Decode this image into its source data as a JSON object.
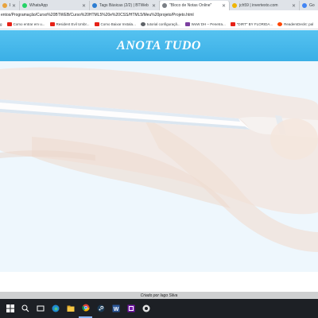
{
  "browser": {
    "tabs": [
      {
        "label": "EUZ | ...",
        "favicon_color": "#e8a33d",
        "active": false
      },
      {
        "label": "WhatsApp",
        "favicon_color": "#25d366",
        "active": false
      },
      {
        "label": "Tags Básicas (2/2) | BTWeb",
        "favicon_color": "#2d7dd2",
        "active": false
      },
      {
        "label": "\"Bloco de Notas Online\"",
        "favicon_color": "#7a7f85",
        "active": true
      },
      {
        "label": "jch59 | invertexto.com",
        "favicon_color": "#f0b400",
        "active": false
      },
      {
        "label": "Go",
        "favicon_color": "#4285f4",
        "active": false
      }
    ],
    "address": "entos/Programação/Curso%20BTWEB/Curso%20HTML5%20e%20CSS/HTML5/Meu%20projeto/Projeto.html",
    "bookmarks": [
      {
        "label": "g",
        "icon": "yt"
      },
      {
        "label": "Como entrar em u...",
        "icon": "yt"
      },
      {
        "label": "Resident Evil Umbr...",
        "icon": "yt"
      },
      {
        "label": "Como Baixar Instala...",
        "icon": "yt"
      },
      {
        "label": "tutorial configuraçã...",
        "icon": "gear"
      },
      {
        "label": "WoW DH – Penetra...",
        "icon": "purple"
      },
      {
        "label": "\"DIRT\" BY FLORIDA...",
        "icon": "yt"
      },
      {
        "label": "ReadersDeckt: pal",
        "icon": "reddit"
      }
    ]
  },
  "page": {
    "title": "ANOTA TUDO",
    "footer": "Criado por Iago Silva",
    "colors": {
      "header_blue": "#45b9ec",
      "background": "#eef7fd",
      "footer_gray": "#cfd0d1"
    }
  },
  "taskbar": {
    "items": [
      {
        "icon": "windows-icon",
        "active": false
      },
      {
        "icon": "search-icon",
        "active": false
      },
      {
        "icon": "task-view-icon",
        "active": false
      },
      {
        "icon": "edge-icon",
        "active": false
      },
      {
        "icon": "file-explorer-icon",
        "active": false
      },
      {
        "icon": "chrome-icon",
        "active": true
      },
      {
        "icon": "steam-icon",
        "active": false
      },
      {
        "icon": "word-icon",
        "active": false
      },
      {
        "icon": "onenote-icon",
        "active": false
      },
      {
        "icon": "app-icon",
        "active": false
      }
    ]
  }
}
